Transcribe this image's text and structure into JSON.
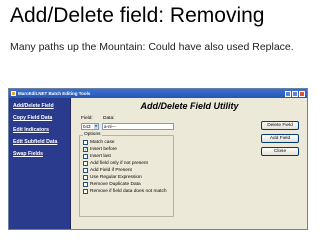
{
  "slide": {
    "title": "Add/Delete field: Removing",
    "subtitle": "Many paths up the Mountain: Could have also used Replace."
  },
  "window": {
    "title": "MarcEdit.NET Batch Editing Tools"
  },
  "sidebar": {
    "items": [
      {
        "label": "Add/Delete Field"
      },
      {
        "label": "Copy Field Data"
      },
      {
        "label": "Edit Indicators"
      },
      {
        "label": "Edit Subfield Data"
      },
      {
        "label": "Swap Fields"
      }
    ]
  },
  "utility": {
    "title": "Add/Delete Field Utility",
    "field_label": "Field:",
    "field_value": "043",
    "data_label": "Data:",
    "data_value": "a-nl---",
    "options_label": "Options",
    "options": [
      {
        "label": "Match case",
        "checked": false
      },
      {
        "label": "Insert before",
        "checked": true
      },
      {
        "label": "Insert last",
        "checked": false
      },
      {
        "label": "Add field only if not present",
        "checked": false
      },
      {
        "label": "Add Field if Present",
        "checked": false
      },
      {
        "label": "Use Regular Expression",
        "checked": false
      },
      {
        "label": "Remove Duplicate Data",
        "checked": false
      },
      {
        "label": "Remove if field data does not match",
        "checked": false
      }
    ],
    "buttons": {
      "delete": "Delete Field",
      "add": "Add Field",
      "close": "Close"
    }
  }
}
